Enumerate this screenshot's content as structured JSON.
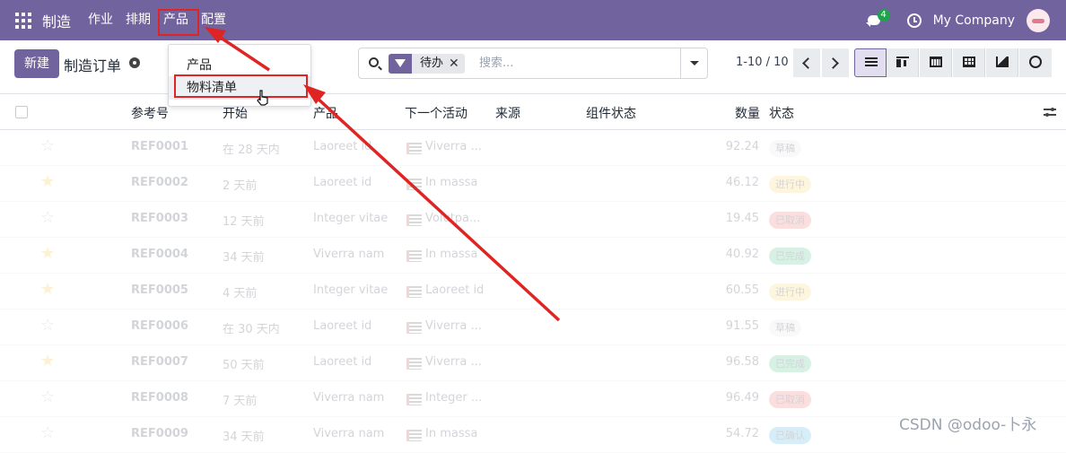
{
  "navbar": {
    "app_name": "制造",
    "menu": [
      "作业",
      "排期",
      "产品",
      "配置"
    ],
    "active_menu_index": 2,
    "chat_badge": "4",
    "company": "My Company"
  },
  "control_panel": {
    "new_label": "新建",
    "title": "制造订单",
    "search": {
      "facet": "待办",
      "placeholder": "搜索..."
    },
    "pager": "1-10 / 10",
    "views": [
      "list",
      "kanban",
      "calendar",
      "pivot",
      "graph",
      "activity"
    ],
    "active_view": "list"
  },
  "dropdown": {
    "items": [
      "产品",
      "物料清单"
    ],
    "highlighted_index": 1
  },
  "table": {
    "headers": {
      "ref": "参考号",
      "start": "开始",
      "product": "产品",
      "activity": "下一个活动",
      "source": "来源",
      "components": "组件状态",
      "qty": "数量",
      "status": "状态"
    },
    "rows": [
      {
        "fav": false,
        "ref": "REF0001",
        "start": "在 28 天内",
        "product": "Laoreet id",
        "activity": "Viverra ...",
        "qty": "92.24",
        "status": "草稿",
        "status_color": "#e5e7eb"
      },
      {
        "fav": true,
        "ref": "REF0002",
        "start": "2 天前",
        "product": "Laoreet id",
        "activity": "In massa",
        "qty": "46.12",
        "status": "进行中",
        "status_color": "#f9d56e"
      },
      {
        "fav": false,
        "ref": "REF0003",
        "start": "12 天前",
        "product": "Integer vitae",
        "activity": "Volutpa...",
        "qty": "19.45",
        "status": "已取消",
        "status_color": "#ef6b6b"
      },
      {
        "fav": true,
        "ref": "REF0004",
        "start": "34 天前",
        "product": "Viverra nam",
        "activity": "In massa",
        "qty": "40.92",
        "status": "已完成",
        "status_color": "#4cc38a"
      },
      {
        "fav": true,
        "ref": "REF0005",
        "start": "4 天前",
        "product": "Integer vitae",
        "activity": "Laoreet id",
        "qty": "60.55",
        "status": "进行中",
        "status_color": "#f9d56e"
      },
      {
        "fav": false,
        "ref": "REF0006",
        "start": "在 30 天内",
        "product": "Laoreet id",
        "activity": "Viverra ...",
        "qty": "91.55",
        "status": "草稿",
        "status_color": "#e5e7eb"
      },
      {
        "fav": true,
        "ref": "REF0007",
        "start": "50 天前",
        "product": "Laoreet id",
        "activity": "Viverra ...",
        "qty": "96.58",
        "status": "已完成",
        "status_color": "#4cc38a"
      },
      {
        "fav": false,
        "ref": "REF0008",
        "start": "7 天前",
        "product": "Viverra nam",
        "activity": "Integer ...",
        "qty": "96.49",
        "status": "已取消",
        "status_color": "#ef6b6b"
      },
      {
        "fav": false,
        "ref": "REF0009",
        "start": "34 天前",
        "product": "Viverra nam",
        "activity": "In massa",
        "qty": "54.72",
        "status": "已确认",
        "status_color": "#4fb3e8"
      }
    ]
  },
  "watermark": "CSDN @odoo-卜永",
  "annotation_color": "#e02424"
}
